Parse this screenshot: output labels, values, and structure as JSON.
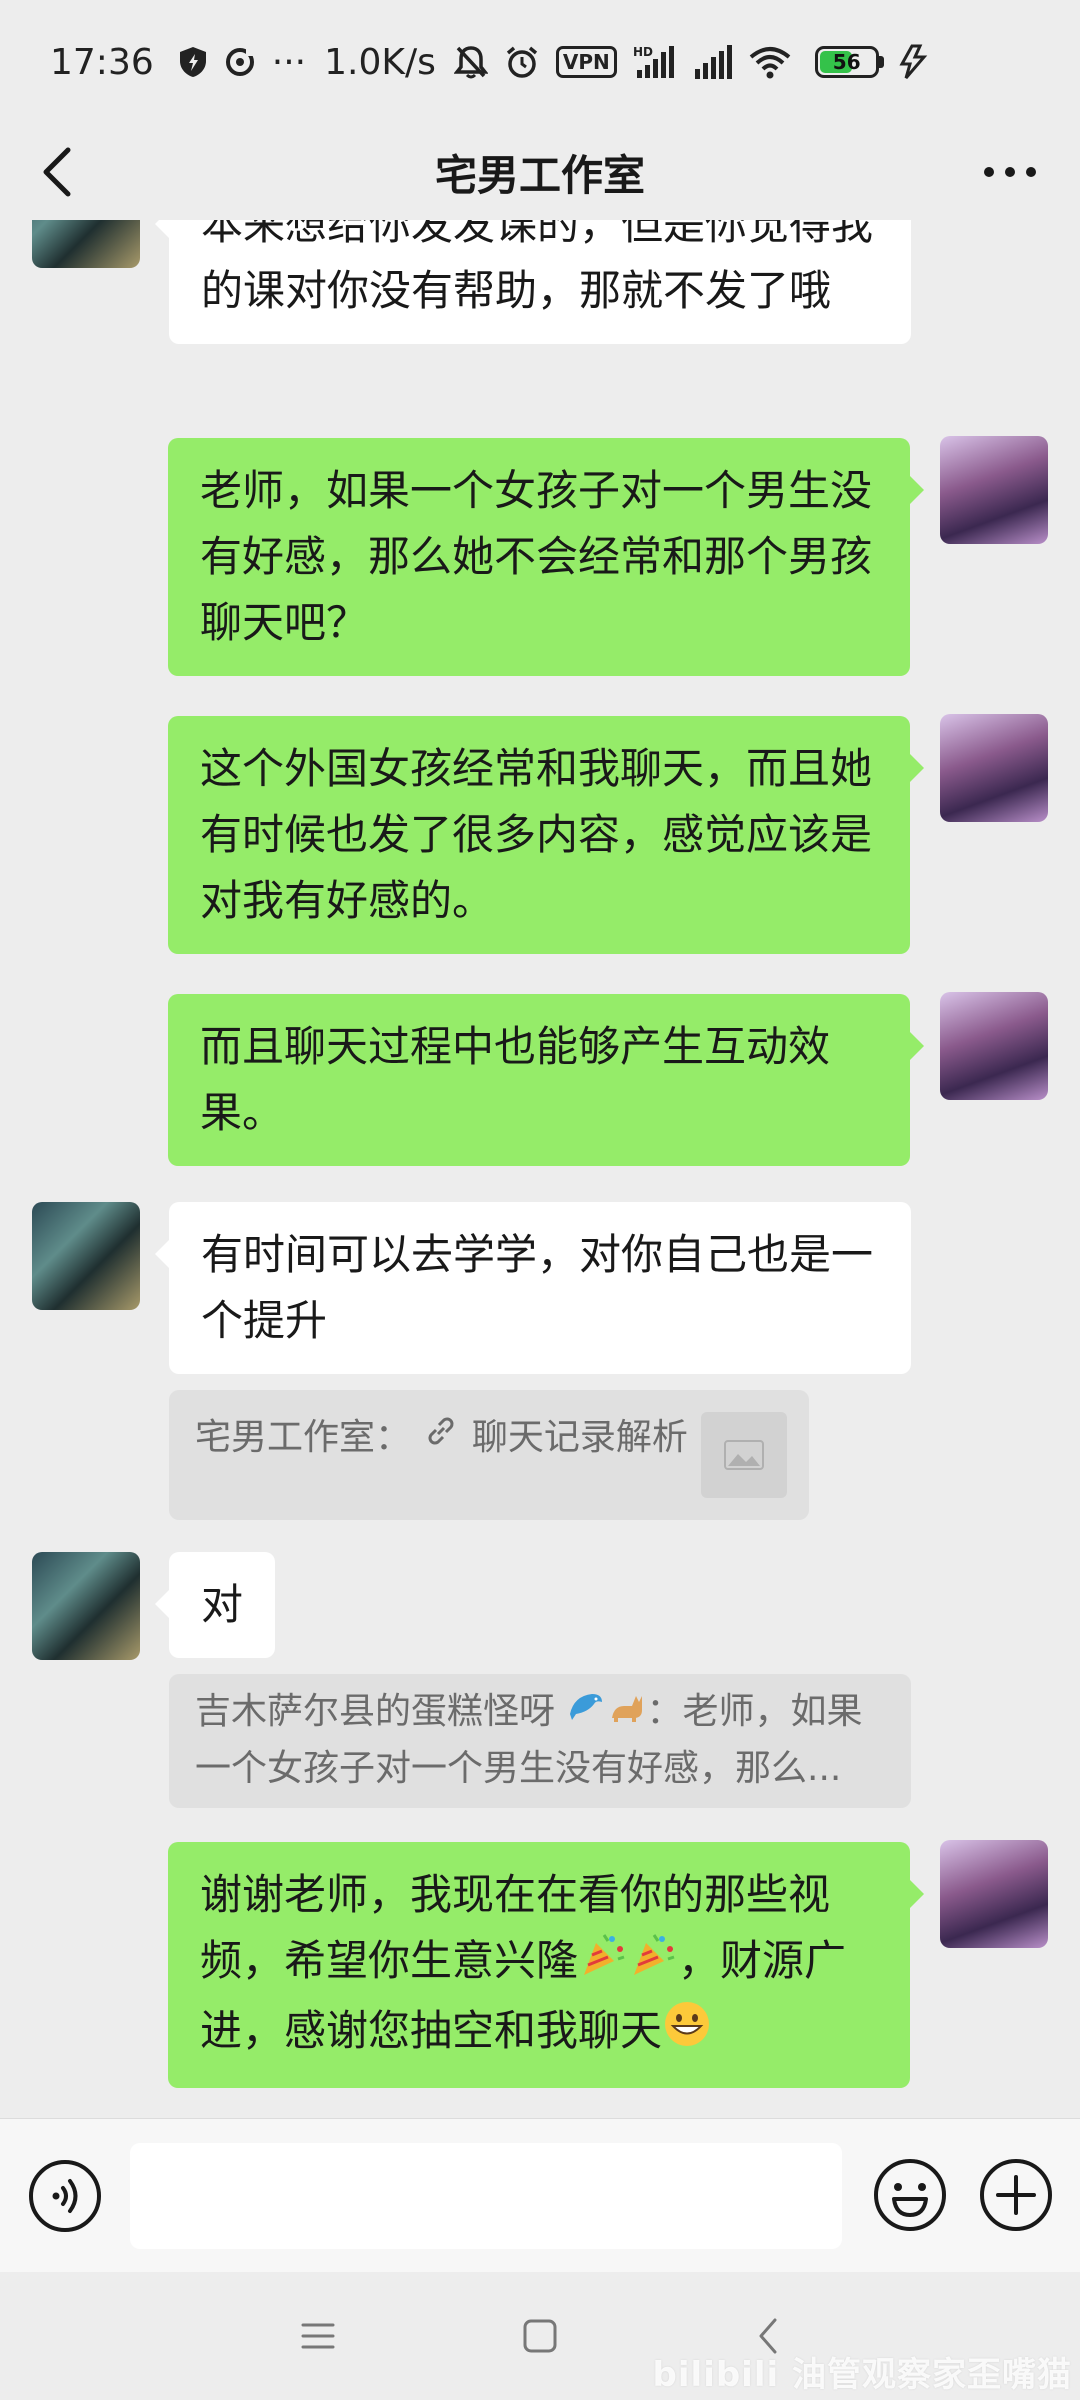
{
  "status_bar": {
    "time": "17:36",
    "dots": "···",
    "net_speed": "1.0K/s",
    "vpn": "VPN",
    "hd": "HD",
    "battery": "56",
    "battery_level": 0.56
  },
  "header": {
    "title": "宅男工作室"
  },
  "messages": [
    {
      "side": "other",
      "text": "本来想给你发发课的，但是你觉得我的课对你没有帮助，那就不发了哦"
    },
    {
      "side": "me",
      "text": "老师，如果一个女孩子对一个男生没有好感，那么她不会经常和那个男孩聊天吧？"
    },
    {
      "side": "me",
      "text": "这个外国女孩经常和我聊天，而且她有时候也发了很多内容，感觉应该是对我有好感的。"
    },
    {
      "side": "me",
      "text": "而且聊天过程中也能够产生互动效果。"
    },
    {
      "side": "other",
      "text": "有时间可以去学学，对你自己也是一个提升"
    },
    {
      "side": "other",
      "text": "对"
    },
    {
      "side": "me",
      "text_a": "谢谢老师，我现在在看你的那些视频，希望你生意兴隆",
      "text_b": "，财源广进，感谢您抽空和我聊天"
    }
  ],
  "quotes": [
    {
      "sender": "宅男工作室：",
      "link_text": "聊天记录解析"
    },
    {
      "sender": "吉木萨尔县的蛋糕怪呀",
      "text_a": "：老师，如果",
      "text_b": "一个女孩子对一个男生没有好感，那么..."
    }
  ],
  "input": {
    "placeholder": ""
  },
  "watermark": "bilibili 油管观察家歪嘴猫",
  "icons": {
    "back": "back-chevron-icon",
    "more": "more-dots-icon",
    "voice": "voice-icon",
    "emoji": "emoji-icon",
    "plus": "plus-icon",
    "nav_menu": "menu-icon",
    "nav_home": "home-square-icon",
    "nav_back": "nav-back-icon"
  },
  "colors": {
    "background": "#ededed",
    "green_bubble": "#95ec69",
    "white_bubble": "#ffffff",
    "quote_bg": "#e0e0e0",
    "battery": "#34c24a"
  }
}
